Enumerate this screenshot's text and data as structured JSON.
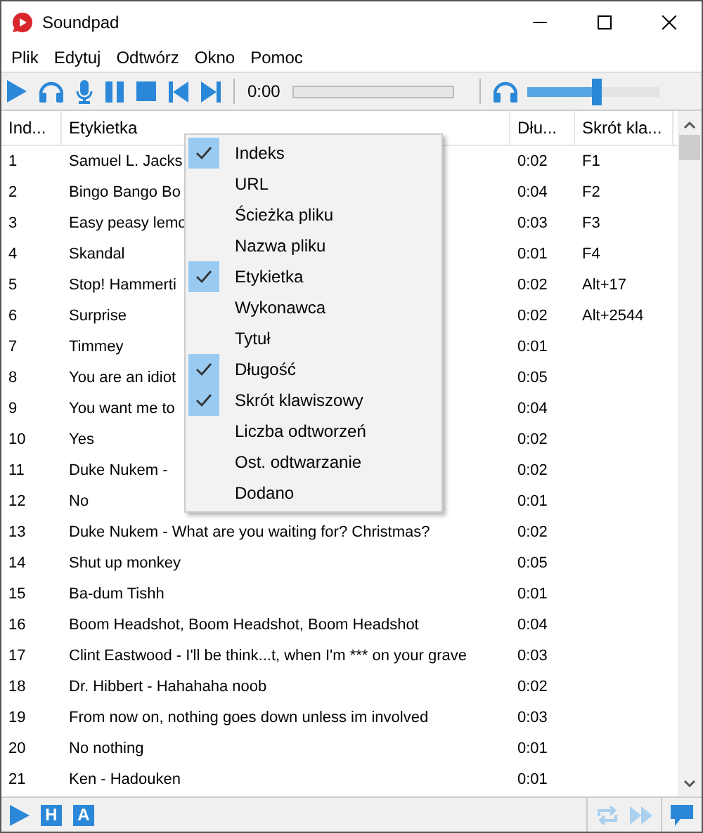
{
  "window": {
    "title": "Soundpad"
  },
  "menu_bar": [
    "Plik",
    "Edytuj",
    "Odtwórz",
    "Okno",
    "Pomoc"
  ],
  "toolbar": {
    "time": "0:00",
    "volume": {
      "level": 0.52
    }
  },
  "table": {
    "columns": [
      "Ind...",
      "Etykietka",
      "Dłu...",
      "Skrót kla..."
    ],
    "rows": [
      {
        "index": "1",
        "label": "Samuel L. Jacks",
        "length": "0:02",
        "shortcut": "F1"
      },
      {
        "index": "2",
        "label": "Bingo Bango Bo",
        "length": "0:04",
        "shortcut": "F2"
      },
      {
        "index": "3",
        "label": "Easy peasy lemo",
        "length": "0:03",
        "shortcut": "F3"
      },
      {
        "index": "4",
        "label": "Skandal",
        "length": "0:01",
        "shortcut": "F4"
      },
      {
        "index": "5",
        "label": "Stop! Hammerti",
        "length": "0:02",
        "shortcut": "Alt+17"
      },
      {
        "index": "6",
        "label": "Surprise",
        "length": "0:02",
        "shortcut": "Alt+2544"
      },
      {
        "index": "7",
        "label": "Timmey",
        "length": "0:01"
      },
      {
        "index": "8",
        "label": "You are an idiot",
        "length": "0:05"
      },
      {
        "index": "9",
        "label": "You want me to",
        "length": "0:04"
      },
      {
        "index": "10",
        "label": "Yes",
        "length": "0:02"
      },
      {
        "index": "11",
        "label": "Duke Nukem -",
        "length": "0:02"
      },
      {
        "index": "12",
        "label": "No",
        "length": "0:01"
      },
      {
        "index": "13",
        "label": "Duke Nukem - What are you waiting for? Christmas?",
        "length": "0:02"
      },
      {
        "index": "14",
        "label": "Shut up monkey",
        "length": "0:05"
      },
      {
        "index": "15",
        "label": "Ba-dum Tishh",
        "length": "0:01"
      },
      {
        "index": "16",
        "label": "Boom Headshot, Boom Headshot, Boom Headshot",
        "length": "0:04"
      },
      {
        "index": "17",
        "label": "Clint Eastwood - I'll be think...t, when I'm *** on your grave",
        "length": "0:03"
      },
      {
        "index": "18",
        "label": "Dr. Hibbert - Hahahaha noob",
        "length": "0:02"
      },
      {
        "index": "19",
        "label": "From now on, nothing goes down unless im involved",
        "length": "0:03"
      },
      {
        "index": "20",
        "label": "No nothing",
        "length": "0:01"
      },
      {
        "index": "21",
        "label": "Ken - Hadouken",
        "length": "0:01"
      }
    ]
  },
  "context_menu": [
    {
      "label": "Indeks",
      "checked": true
    },
    {
      "label": "URL",
      "checked": false
    },
    {
      "label": "Ścieżka pliku",
      "checked": false
    },
    {
      "label": "Nazwa pliku",
      "checked": false
    },
    {
      "label": "Etykietka",
      "checked": true
    },
    {
      "label": "Wykonawca",
      "checked": false
    },
    {
      "label": "Tytuł",
      "checked": false
    },
    {
      "label": "Długość",
      "checked": true
    },
    {
      "label": "Skrót klawiszowy",
      "checked": true
    },
    {
      "label": "Liczba odtworzeń",
      "checked": false
    },
    {
      "label": "Ost. odtwarzanie",
      "checked": false
    },
    {
      "label": "Dodano",
      "checked": false
    }
  ],
  "status_bar": {
    "letter_buttons": [
      "H",
      "A"
    ]
  }
}
